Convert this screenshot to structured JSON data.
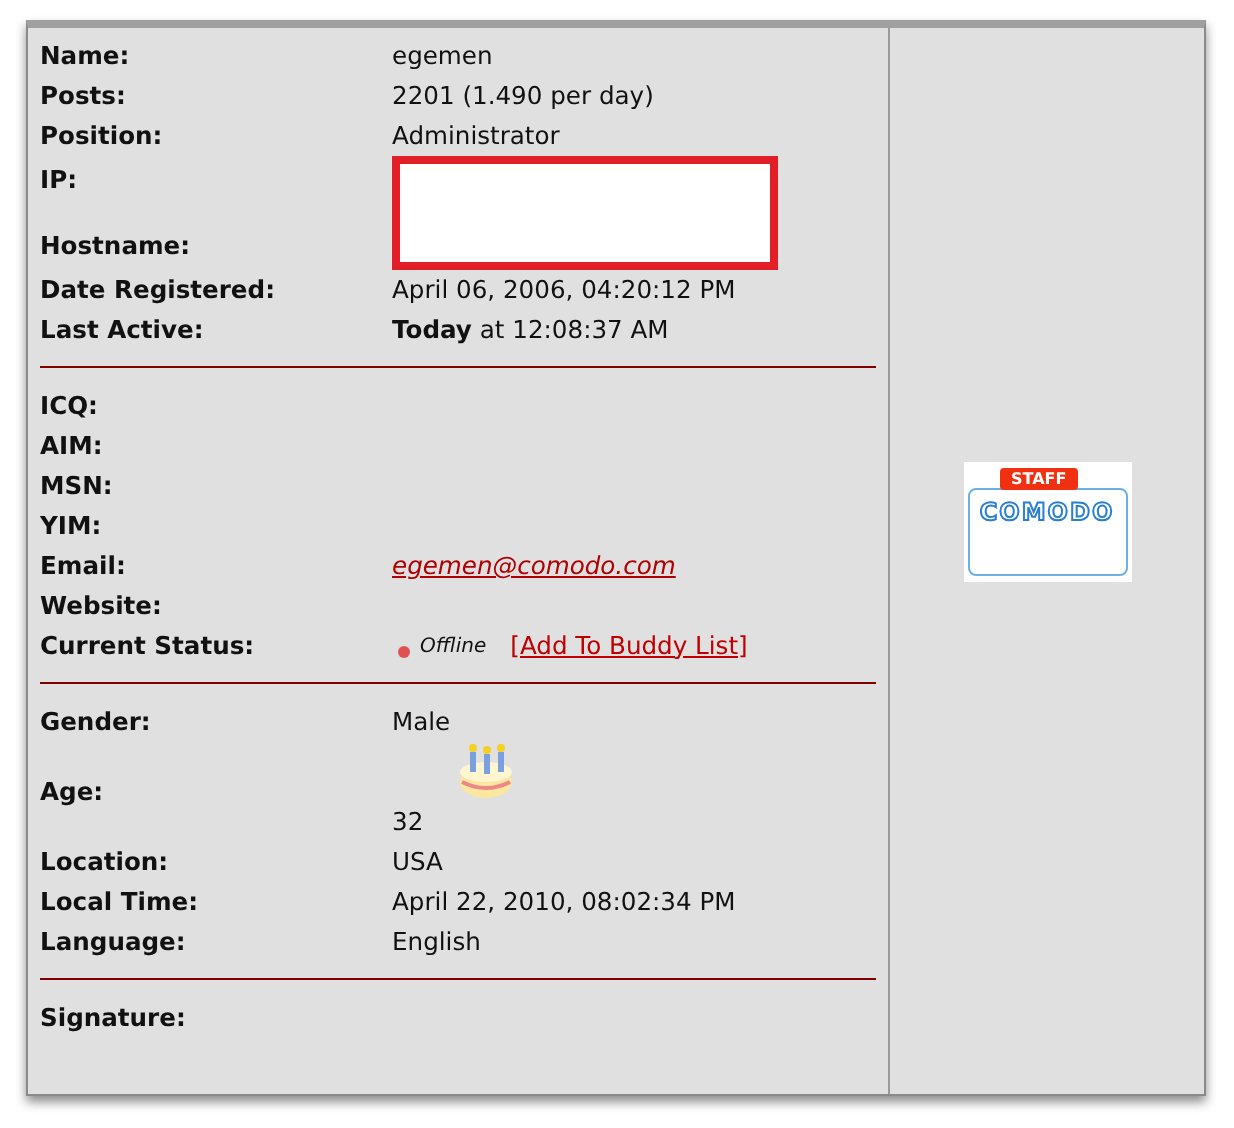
{
  "sections": [
    {
      "rows": [
        {
          "kind": "text",
          "label": "Name:",
          "value": "egemen"
        },
        {
          "kind": "text",
          "label": "Posts:",
          "value": "2201 (1.490 per day)"
        },
        {
          "kind": "text",
          "label": "Position:",
          "value": "Administrator"
        },
        {
          "kind": "redacted",
          "labels": [
            "IP:",
            "Hostname:"
          ]
        },
        {
          "kind": "text",
          "label": "Date Registered:",
          "value": "April 06, 2006, 04:20:12 PM"
        },
        {
          "kind": "text",
          "label": "Last Active:",
          "value": "**Today** at 12:08:37 AM"
        }
      ]
    },
    {
      "rows": [
        {
          "kind": "text",
          "label": "ICQ:"
        },
        {
          "kind": "text",
          "label": "AIM:"
        },
        {
          "kind": "text",
          "label": "MSN:"
        },
        {
          "kind": "text",
          "label": "YIM:"
        },
        {
          "kind": "email",
          "label": "Email:",
          "value": "egemen@comodo.com"
        },
        {
          "kind": "text",
          "label": "Website:"
        },
        {
          "kind": "status",
          "label": "Current Status:",
          "online": false,
          "status": "Offline",
          "link": "[Add To Buddy List]"
        }
      ]
    },
    {
      "rows": [
        {
          "kind": "text",
          "label": "Gender:",
          "value": "Male"
        },
        {
          "kind": "age",
          "label": "Age:",
          "value": "32",
          "birthday": true
        },
        {
          "kind": "text",
          "label": "Location:",
          "value": "USA"
        },
        {
          "kind": "text",
          "label": "Local Time:",
          "value": "April 22, 2010, 08:02:34 PM"
        },
        {
          "kind": "text",
          "label": "Language:",
          "value": "English"
        }
      ]
    },
    {
      "rows": [
        {
          "kind": "text",
          "label": "Signature:"
        }
      ]
    }
  ],
  "badge": {
    "top": "STAFF",
    "main": "COMODO"
  }
}
